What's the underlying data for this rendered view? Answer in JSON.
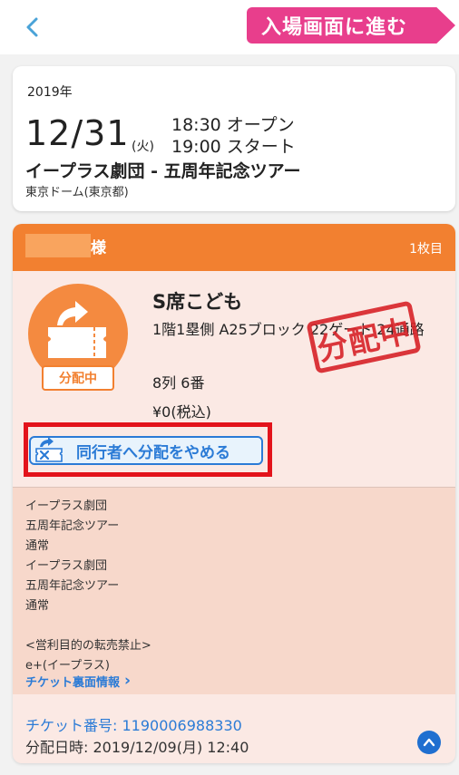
{
  "header": {
    "back_icon": "chevron-left-icon",
    "enter_button": "入場画面に進む",
    "colors": {
      "accent": "#e83e8c",
      "back_icon": "#4aa3d8"
    }
  },
  "event": {
    "year": "2019年",
    "date": "12/31",
    "weekday": "(火)",
    "open_time": "18:30 オープン",
    "start_time": "19:00 スタート",
    "title": "イープラス劇団 - 五周年記念ツアー",
    "venue": "東京ドーム(東京都)"
  },
  "ticket": {
    "holder_suffix": "様",
    "count": "1枚目",
    "status_badge": "分配中",
    "stamp": "分配中",
    "seat_type": "S席こども",
    "seat_location": "1階1塁側 A25ブロック 22ゲート 24通路",
    "seat_row": "8列 6番",
    "price": "¥0(税込)",
    "cancel_button": "同行者へ分配をやめる",
    "notes": [
      "イープラス劇団",
      "五周年記念ツアー",
      "通常",
      "イープラス劇団",
      "五周年記念ツアー",
      "通常",
      "",
      "<営利目的の転売禁止>",
      "e+(イープラス)"
    ],
    "back_info_link": "チケット裏面情報",
    "back_info_chevron": "›",
    "ticket_number": "チケット番号: 1190006988330",
    "distribution_date": "分配日時: 2019/12/09(月) 12:40",
    "icons": [
      "ticket-share-icon",
      "cancel-share-icon",
      "chevron-up-icon"
    ],
    "colors": {
      "header": "#f28030",
      "body": "#fbe9e4",
      "notes": "#f7d8cb",
      "stamp": "#d8262c",
      "link": "#2b7bd6",
      "highlight": "#e3131b"
    }
  }
}
